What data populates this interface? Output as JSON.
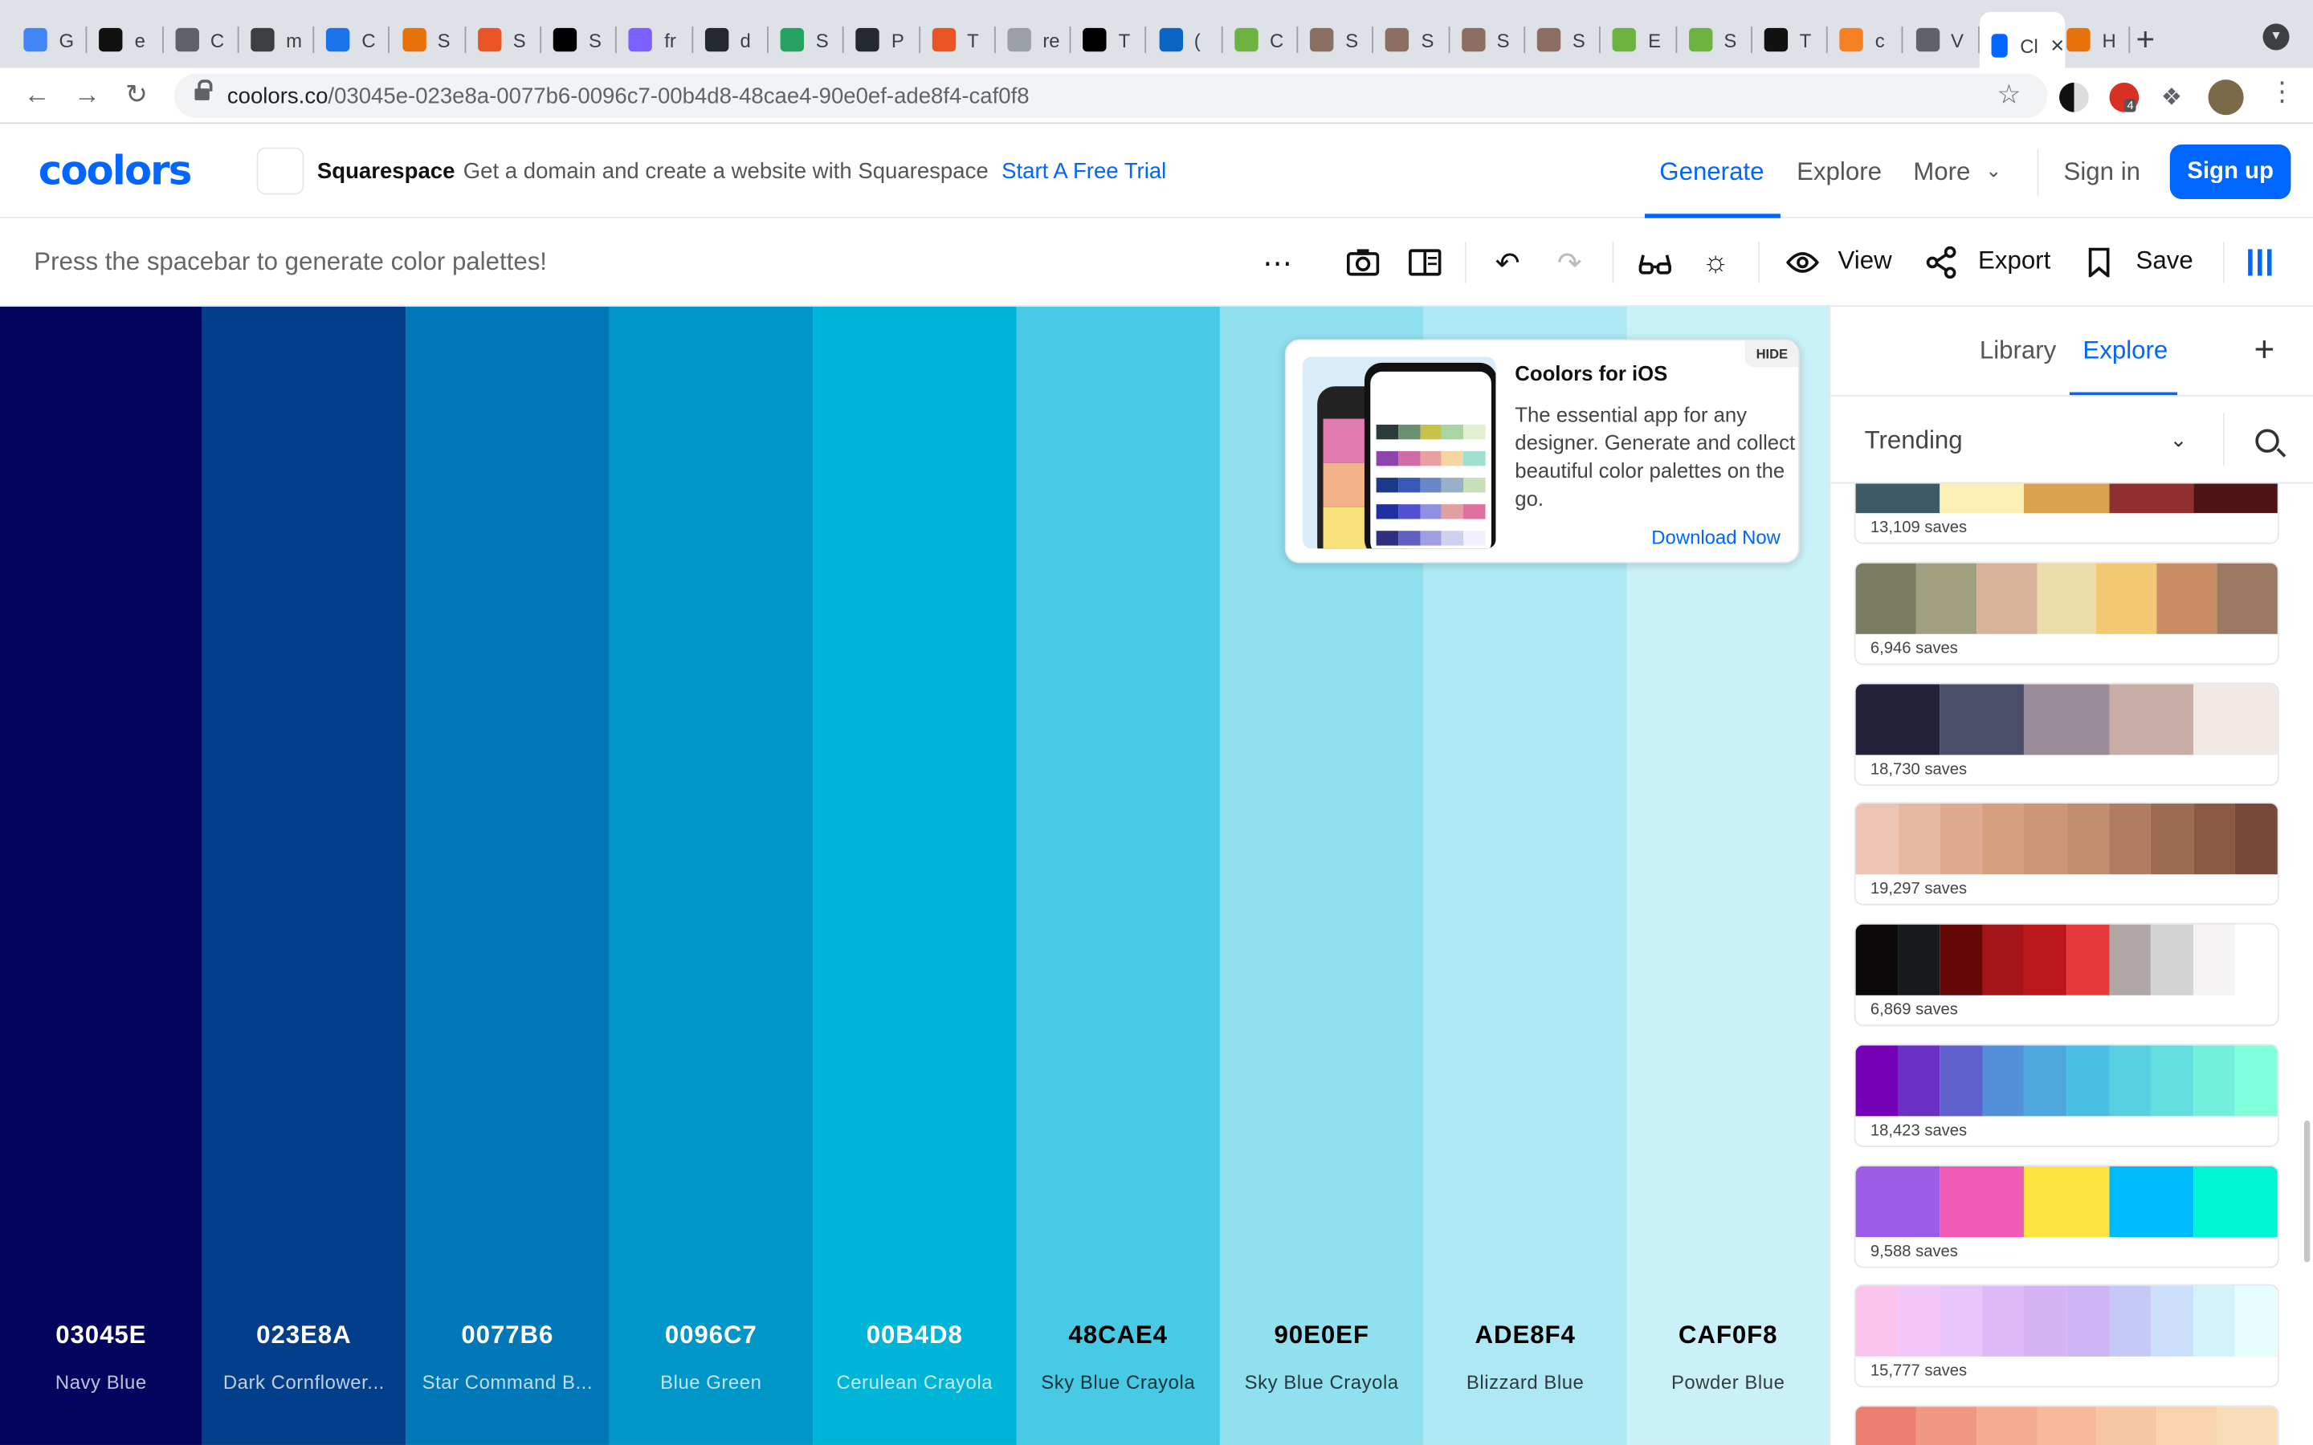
{
  "browser": {
    "tabs": [
      {
        "label": "G",
        "color": "#4285f4"
      },
      {
        "label": "e",
        "color": "#111111"
      },
      {
        "label": "C",
        "color": "#5f6368"
      },
      {
        "label": "m",
        "color": "#3c4043"
      },
      {
        "label": "C",
        "color": "#1a73e8"
      },
      {
        "label": "S",
        "color": "#e8710a"
      },
      {
        "label": "S",
        "color": "#eb5424"
      },
      {
        "label": "S",
        "color": "#000000"
      },
      {
        "label": "fr",
        "color": "#7b61ff"
      },
      {
        "label": "d",
        "color": "#24292e"
      },
      {
        "label": "S",
        "color": "#25a162"
      },
      {
        "label": "P",
        "color": "#24292e"
      },
      {
        "label": "T",
        "color": "#eb5424"
      },
      {
        "label": "re",
        "color": "#9aa0a6"
      },
      {
        "label": "T",
        "color": "#000000"
      },
      {
        "label": "(",
        "color": "#0a66c2"
      },
      {
        "label": "C",
        "color": "#6db33f"
      },
      {
        "label": "S",
        "color": "#8d6e63"
      },
      {
        "label": "S",
        "color": "#8d6e63"
      },
      {
        "label": "S",
        "color": "#8d6e63"
      },
      {
        "label": "S",
        "color": "#8d6e63"
      },
      {
        "label": "E",
        "color": "#6db33f"
      },
      {
        "label": "S",
        "color": "#6db33f"
      },
      {
        "label": "T",
        "color": "#111111"
      },
      {
        "label": "c",
        "color": "#f48024"
      },
      {
        "label": "V",
        "color": "#5f6368"
      },
      {
        "label": "Cl",
        "color": "#0066ff"
      },
      {
        "label": "H",
        "color": "#e8710a"
      }
    ],
    "new_tab": "+",
    "url_host": "coolors.co",
    "url_path": "/03045e-023e8a-0077b6-0096c7-00b4d8-48cae4-90e0ef-ade8f4-caf0f8",
    "ext_badge": "4"
  },
  "header": {
    "logo": "coolors",
    "sponsor_name": "Squarespace",
    "sponsor_text": "Get a domain and create a website with Squarespace",
    "sponsor_link": "Start A Free Trial",
    "nav": {
      "generate": "Generate",
      "explore": "Explore",
      "more": "More"
    },
    "sign_in": "Sign in",
    "sign_up": "Sign up"
  },
  "toolbar": {
    "hint": "Press the spacebar to generate color palettes!",
    "more_icon": "⋯",
    "view": "View",
    "export": "Export",
    "save": "Save"
  },
  "palette": [
    {
      "hex": "03045E",
      "name": "Navy Blue",
      "color": "#03045e",
      "text": "#ffffff"
    },
    {
      "hex": "023E8A",
      "name": "Dark Cornflower...",
      "color": "#023e8a",
      "text": "#ffffff"
    },
    {
      "hex": "0077B6",
      "name": "Star Command B...",
      "color": "#0077b6",
      "text": "#ffffff"
    },
    {
      "hex": "0096C7",
      "name": "Blue Green",
      "color": "#0096c7",
      "text": "#ffffff"
    },
    {
      "hex": "00B4D8",
      "name": "Cerulean Crayola",
      "color": "#00b4d8",
      "text": "#ffffff"
    },
    {
      "hex": "48CAE4",
      "name": "Sky Blue Crayola",
      "color": "#48cae4",
      "text": "#000000"
    },
    {
      "hex": "90E0EF",
      "name": "Sky Blue Crayola",
      "color": "#90e0ef",
      "text": "#000000"
    },
    {
      "hex": "ADE8F4",
      "name": "Blizzard Blue",
      "color": "#ade8f4",
      "text": "#000000"
    },
    {
      "hex": "CAF0F8",
      "name": "Powder Blue",
      "color": "#caf0f8",
      "text": "#000000"
    }
  ],
  "ad": {
    "title": "Coolors for iOS",
    "body": "The essential app for any designer. Generate and collect beautiful color palettes on the go.",
    "link": "Download Now",
    "hide": "HIDE"
  },
  "panel": {
    "tabs": {
      "library": "Library",
      "explore": "Explore"
    },
    "add": "+",
    "sort": "Trending",
    "palettes": [
      {
        "saves": "13,109 saves",
        "colors": [
          "#3d5a66",
          "#fdf0b4",
          "#d9a24e",
          "#8f2f2f",
          "#4c1414"
        ]
      },
      {
        "saves": "6,946 saves",
        "colors": [
          "#7a7d62",
          "#a09f7f",
          "#d8b29a",
          "#ecdca9",
          "#f3c873",
          "#c98d66",
          "#9b7a65"
        ]
      },
      {
        "saves": "18,730 saves",
        "colors": [
          "#22223b",
          "#4a4e69",
          "#9a8c98",
          "#c9ada7",
          "#f2e9e4"
        ]
      },
      {
        "saves": "19,297 saves",
        "colors": [
          "#edc4b3",
          "#e6b8a2",
          "#deab90",
          "#d69f7e",
          "#cd9777",
          "#c38e70",
          "#b07d62",
          "#9d6b53",
          "#8a5a44",
          "#774936"
        ]
      },
      {
        "saves": "6,869 saves",
        "colors": [
          "#0b090a",
          "#161a1d",
          "#660708",
          "#a4161a",
          "#ba181b",
          "#e5383b",
          "#b1a7a6",
          "#d3d3d3",
          "#f5f3f4",
          "#ffffff"
        ]
      },
      {
        "saves": "18,423 saves",
        "colors": [
          "#7400b8",
          "#6930c3",
          "#5e60ce",
          "#5390d9",
          "#4ea8de",
          "#48bfe3",
          "#56cfe1",
          "#64dfdf",
          "#72efdd",
          "#80ffdb"
        ]
      },
      {
        "saves": "9,588 saves",
        "colors": [
          "#9b5de5",
          "#f15bb5",
          "#fee440",
          "#00bbf9",
          "#00f5d4"
        ]
      },
      {
        "saves": "15,777 saves",
        "colors": [
          "#fbc4ec",
          "#f2c6f7",
          "#e8c5fb",
          "#deb8f7",
          "#d5b3f4",
          "#cdb4f4",
          "#c6c8f7",
          "#cde0fb",
          "#d3f3fb",
          "#e6fffd"
        ]
      },
      {
        "saves": "",
        "colors": [
          "#eb7d73",
          "#f09882",
          "#f4ab8f",
          "#f6b99a",
          "#f7c7a4",
          "#f8d3ae",
          "#f8ddb8"
        ]
      }
    ]
  }
}
